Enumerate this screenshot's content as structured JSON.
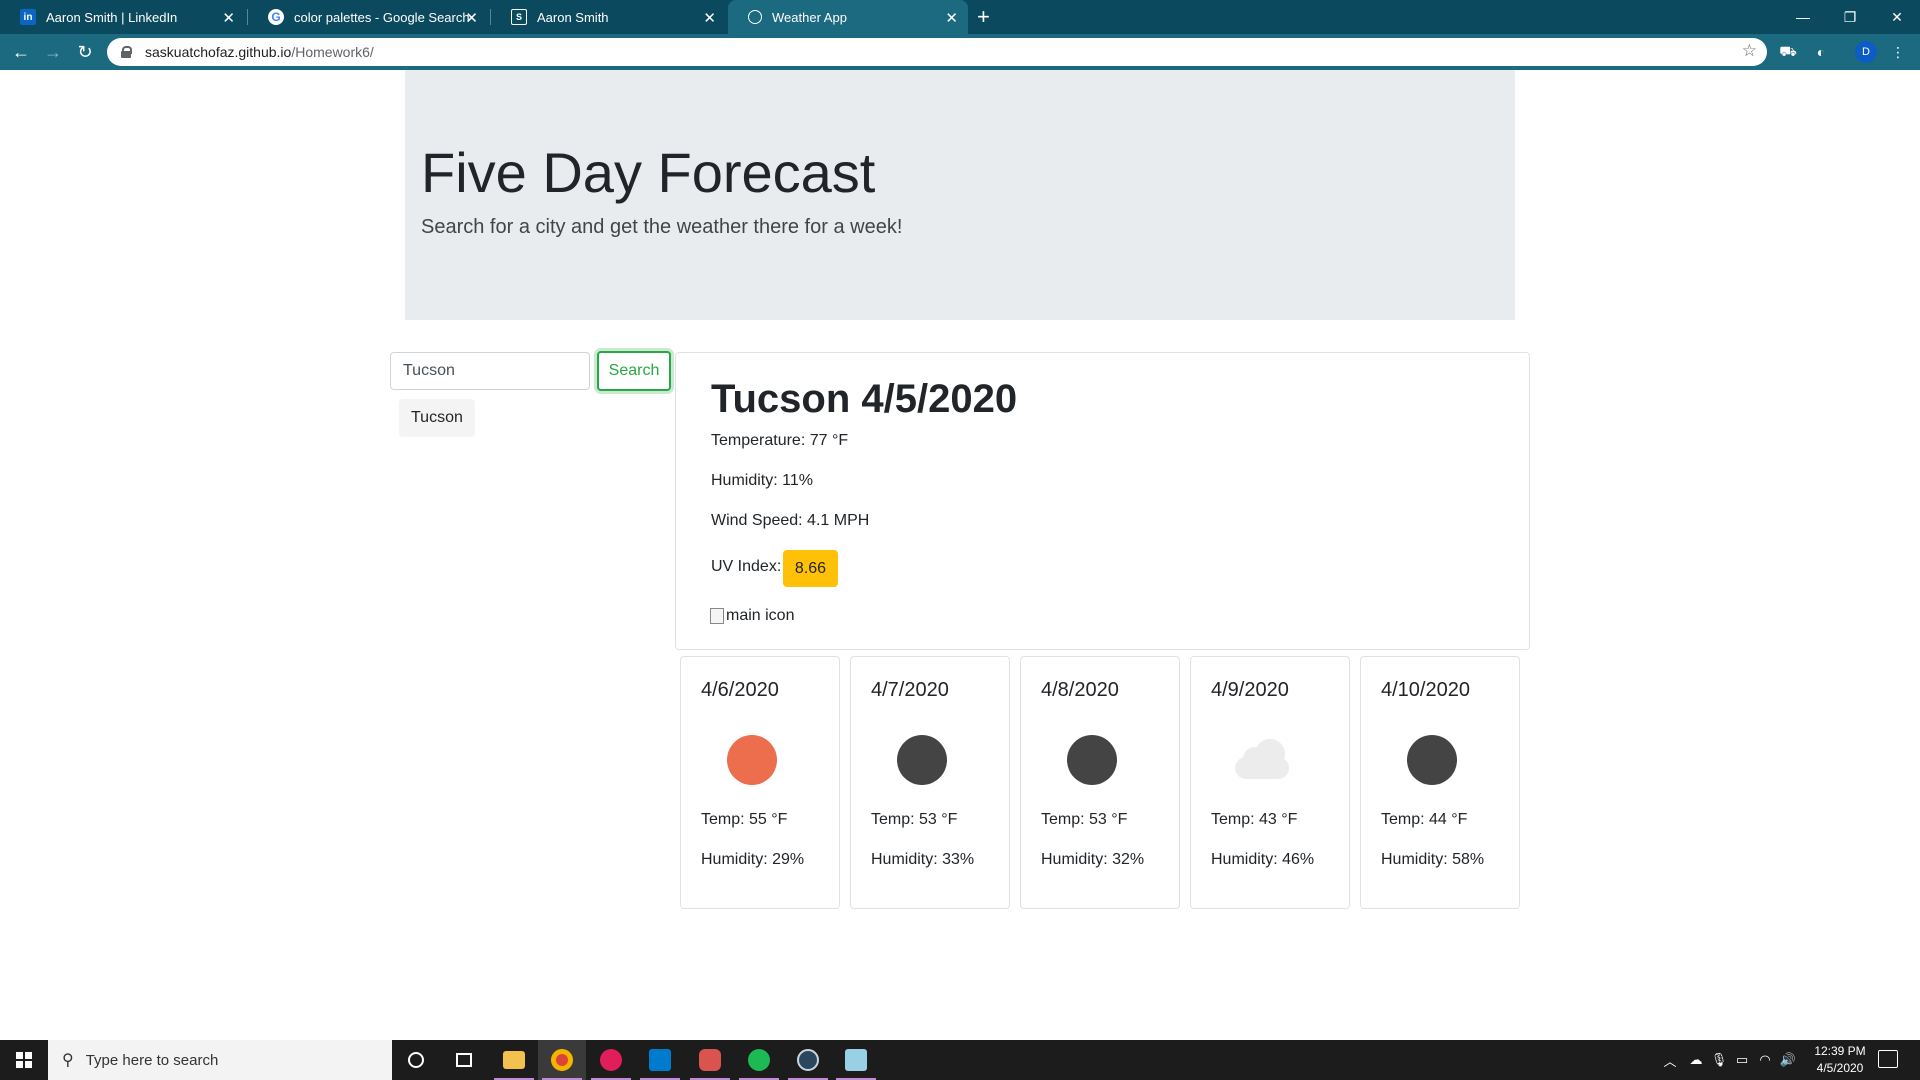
{
  "browser": {
    "tabs": [
      {
        "label": "Aaron Smith | LinkedIn",
        "icon": "linkedin-icon"
      },
      {
        "label": "color palettes - Google Search",
        "icon": "google-icon"
      },
      {
        "label": "Aaron Smith",
        "icon": "site-icon"
      },
      {
        "label": "Weather App",
        "icon": "globe-icon"
      }
    ],
    "url_host": "saskuatchofaz.github.io",
    "url_path": "/Homework6/",
    "profile_initial": "D",
    "theme_color": "#0b4a5e"
  },
  "page": {
    "title": "Five Day Forecast",
    "subtitle": "Search for a city and get the weather there for a week!",
    "search": {
      "value": "Tucson",
      "button_label": "Search"
    },
    "history": [
      "Tucson"
    ],
    "current": {
      "heading": "Tucson 4/5/2020",
      "temperature": "Temperature: 77 °F",
      "humidity": "Humidity: 11%",
      "wind": "Wind Speed: 4.1 MPH",
      "uv_label": "UV Index:",
      "uv_value": "8.66",
      "uv_color": "#ffc107",
      "icon_alt": "main icon"
    },
    "forecast": [
      {
        "date": "4/6/2020",
        "icon": "sun-icon",
        "temp": "Temp: 55 °F",
        "humidity": "Humidity: 29%"
      },
      {
        "date": "4/7/2020",
        "icon": "dark-circle-icon",
        "temp": "Temp: 53 °F",
        "humidity": "Humidity: 33%"
      },
      {
        "date": "4/8/2020",
        "icon": "dark-circle-icon",
        "temp": "Temp: 53 °F",
        "humidity": "Humidity: 32%"
      },
      {
        "date": "4/9/2020",
        "icon": "cloud-icon",
        "temp": "Temp: 43 °F",
        "humidity": "Humidity: 46%"
      },
      {
        "date": "4/10/2020",
        "icon": "dark-circle-icon",
        "temp": "Temp: 44 °F",
        "humidity": "Humidity: 58%"
      }
    ]
  },
  "taskbar": {
    "search_placeholder": "Type here to search",
    "time": "12:39 PM",
    "date": "4/5/2020"
  }
}
